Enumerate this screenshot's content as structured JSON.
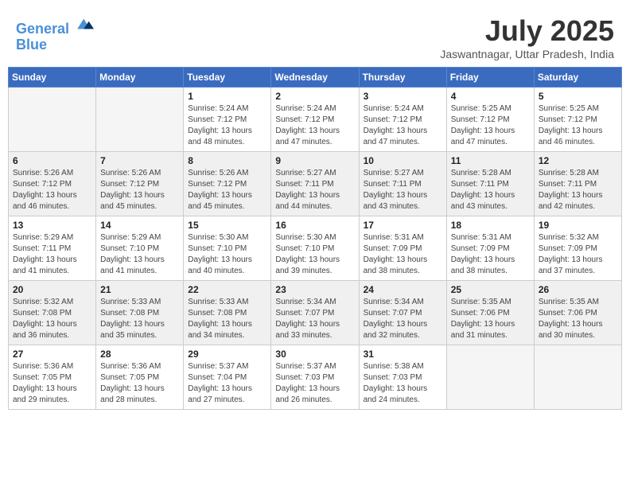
{
  "header": {
    "logo_line1": "General",
    "logo_line2": "Blue",
    "month": "July 2025",
    "location": "Jaswantnagar, Uttar Pradesh, India"
  },
  "days_of_week": [
    "Sunday",
    "Monday",
    "Tuesday",
    "Wednesday",
    "Thursday",
    "Friday",
    "Saturday"
  ],
  "weeks": [
    [
      {
        "day": "",
        "info": ""
      },
      {
        "day": "",
        "info": ""
      },
      {
        "day": "1",
        "info": "Sunrise: 5:24 AM\nSunset: 7:12 PM\nDaylight: 13 hours\nand 48 minutes."
      },
      {
        "day": "2",
        "info": "Sunrise: 5:24 AM\nSunset: 7:12 PM\nDaylight: 13 hours\nand 47 minutes."
      },
      {
        "day": "3",
        "info": "Sunrise: 5:24 AM\nSunset: 7:12 PM\nDaylight: 13 hours\nand 47 minutes."
      },
      {
        "day": "4",
        "info": "Sunrise: 5:25 AM\nSunset: 7:12 PM\nDaylight: 13 hours\nand 47 minutes."
      },
      {
        "day": "5",
        "info": "Sunrise: 5:25 AM\nSunset: 7:12 PM\nDaylight: 13 hours\nand 46 minutes."
      }
    ],
    [
      {
        "day": "6",
        "info": "Sunrise: 5:26 AM\nSunset: 7:12 PM\nDaylight: 13 hours\nand 46 minutes."
      },
      {
        "day": "7",
        "info": "Sunrise: 5:26 AM\nSunset: 7:12 PM\nDaylight: 13 hours\nand 45 minutes."
      },
      {
        "day": "8",
        "info": "Sunrise: 5:26 AM\nSunset: 7:12 PM\nDaylight: 13 hours\nand 45 minutes."
      },
      {
        "day": "9",
        "info": "Sunrise: 5:27 AM\nSunset: 7:11 PM\nDaylight: 13 hours\nand 44 minutes."
      },
      {
        "day": "10",
        "info": "Sunrise: 5:27 AM\nSunset: 7:11 PM\nDaylight: 13 hours\nand 43 minutes."
      },
      {
        "day": "11",
        "info": "Sunrise: 5:28 AM\nSunset: 7:11 PM\nDaylight: 13 hours\nand 43 minutes."
      },
      {
        "day": "12",
        "info": "Sunrise: 5:28 AM\nSunset: 7:11 PM\nDaylight: 13 hours\nand 42 minutes."
      }
    ],
    [
      {
        "day": "13",
        "info": "Sunrise: 5:29 AM\nSunset: 7:11 PM\nDaylight: 13 hours\nand 41 minutes."
      },
      {
        "day": "14",
        "info": "Sunrise: 5:29 AM\nSunset: 7:10 PM\nDaylight: 13 hours\nand 41 minutes."
      },
      {
        "day": "15",
        "info": "Sunrise: 5:30 AM\nSunset: 7:10 PM\nDaylight: 13 hours\nand 40 minutes."
      },
      {
        "day": "16",
        "info": "Sunrise: 5:30 AM\nSunset: 7:10 PM\nDaylight: 13 hours\nand 39 minutes."
      },
      {
        "day": "17",
        "info": "Sunrise: 5:31 AM\nSunset: 7:09 PM\nDaylight: 13 hours\nand 38 minutes."
      },
      {
        "day": "18",
        "info": "Sunrise: 5:31 AM\nSunset: 7:09 PM\nDaylight: 13 hours\nand 38 minutes."
      },
      {
        "day": "19",
        "info": "Sunrise: 5:32 AM\nSunset: 7:09 PM\nDaylight: 13 hours\nand 37 minutes."
      }
    ],
    [
      {
        "day": "20",
        "info": "Sunrise: 5:32 AM\nSunset: 7:08 PM\nDaylight: 13 hours\nand 36 minutes."
      },
      {
        "day": "21",
        "info": "Sunrise: 5:33 AM\nSunset: 7:08 PM\nDaylight: 13 hours\nand 35 minutes."
      },
      {
        "day": "22",
        "info": "Sunrise: 5:33 AM\nSunset: 7:08 PM\nDaylight: 13 hours\nand 34 minutes."
      },
      {
        "day": "23",
        "info": "Sunrise: 5:34 AM\nSunset: 7:07 PM\nDaylight: 13 hours\nand 33 minutes."
      },
      {
        "day": "24",
        "info": "Sunrise: 5:34 AM\nSunset: 7:07 PM\nDaylight: 13 hours\nand 32 minutes."
      },
      {
        "day": "25",
        "info": "Sunrise: 5:35 AM\nSunset: 7:06 PM\nDaylight: 13 hours\nand 31 minutes."
      },
      {
        "day": "26",
        "info": "Sunrise: 5:35 AM\nSunset: 7:06 PM\nDaylight: 13 hours\nand 30 minutes."
      }
    ],
    [
      {
        "day": "27",
        "info": "Sunrise: 5:36 AM\nSunset: 7:05 PM\nDaylight: 13 hours\nand 29 minutes."
      },
      {
        "day": "28",
        "info": "Sunrise: 5:36 AM\nSunset: 7:05 PM\nDaylight: 13 hours\nand 28 minutes."
      },
      {
        "day": "29",
        "info": "Sunrise: 5:37 AM\nSunset: 7:04 PM\nDaylight: 13 hours\nand 27 minutes."
      },
      {
        "day": "30",
        "info": "Sunrise: 5:37 AM\nSunset: 7:03 PM\nDaylight: 13 hours\nand 26 minutes."
      },
      {
        "day": "31",
        "info": "Sunrise: 5:38 AM\nSunset: 7:03 PM\nDaylight: 13 hours\nand 24 minutes."
      },
      {
        "day": "",
        "info": ""
      },
      {
        "day": "",
        "info": ""
      }
    ]
  ]
}
